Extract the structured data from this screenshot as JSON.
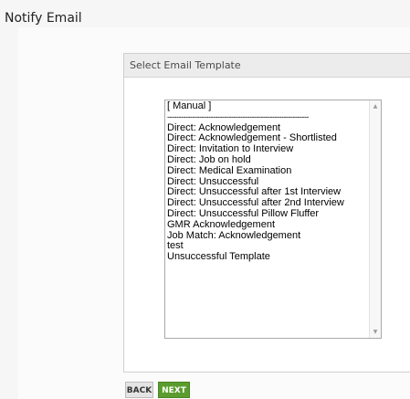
{
  "page": {
    "title": "Notify Email"
  },
  "panel": {
    "header": "Select Email Template"
  },
  "templates": {
    "items": [
      "[ Manual ]",
      "--------------------------------------------------------------",
      "Direct: Acknowledgement",
      "Direct: Acknowledgement - Shortlisted",
      "Direct: Invitation to Interview",
      "Direct: Job on hold",
      "Direct: Medical Examination",
      "Direct: Unsuccessful",
      "Direct: Unsuccessful after 1st Interview",
      "Direct: Unsuccessful after 2nd Interview",
      "Direct: Unsuccessful Pillow Fluffer",
      "GMR Acknowledgement",
      "Job Match: Acknowledgement",
      "test",
      "Unsuccessful Template"
    ],
    "scroll_up_icon": "▲",
    "scroll_down_icon": "▼"
  },
  "buttons": {
    "back_label": "BACK",
    "next_label": "NEXT"
  },
  "colors": {
    "next_button": "#5a9c2e",
    "back_button": "#e4e4e4",
    "panel_header": "#ececec"
  }
}
